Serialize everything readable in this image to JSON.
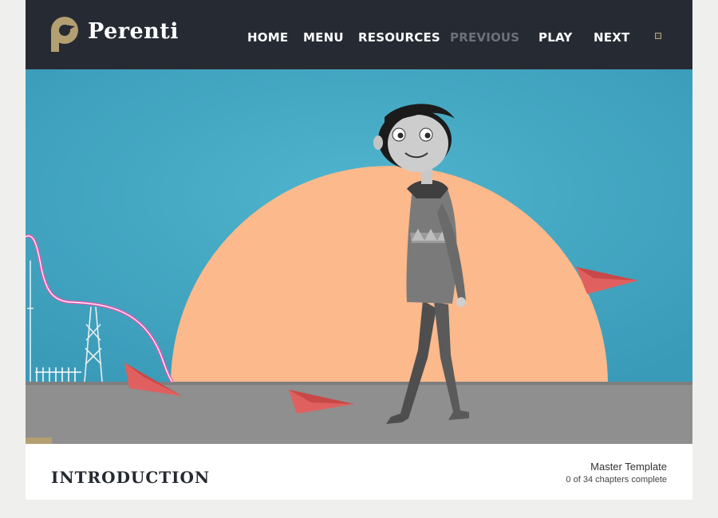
{
  "brand": {
    "name": "Perenti",
    "accent": "#b49f71"
  },
  "nav": {
    "items": [
      {
        "label": "HOME",
        "state": "enabled"
      },
      {
        "label": "MENU",
        "state": "enabled"
      },
      {
        "label": "RESOURCES",
        "state": "enabled"
      },
      {
        "label": "PREVIOUS",
        "state": "disabled"
      },
      {
        "label": "PLAY",
        "state": "enabled"
      },
      {
        "label": "NEXT",
        "state": "enabled"
      }
    ],
    "fullscreen_icon": "window-square-icon"
  },
  "video": {
    "progress_fraction": 0.04
  },
  "footer": {
    "chapter_title": "INTRODUCTION",
    "course_name": "Master Template",
    "course_progress": "0 of 34 chapters complete"
  }
}
